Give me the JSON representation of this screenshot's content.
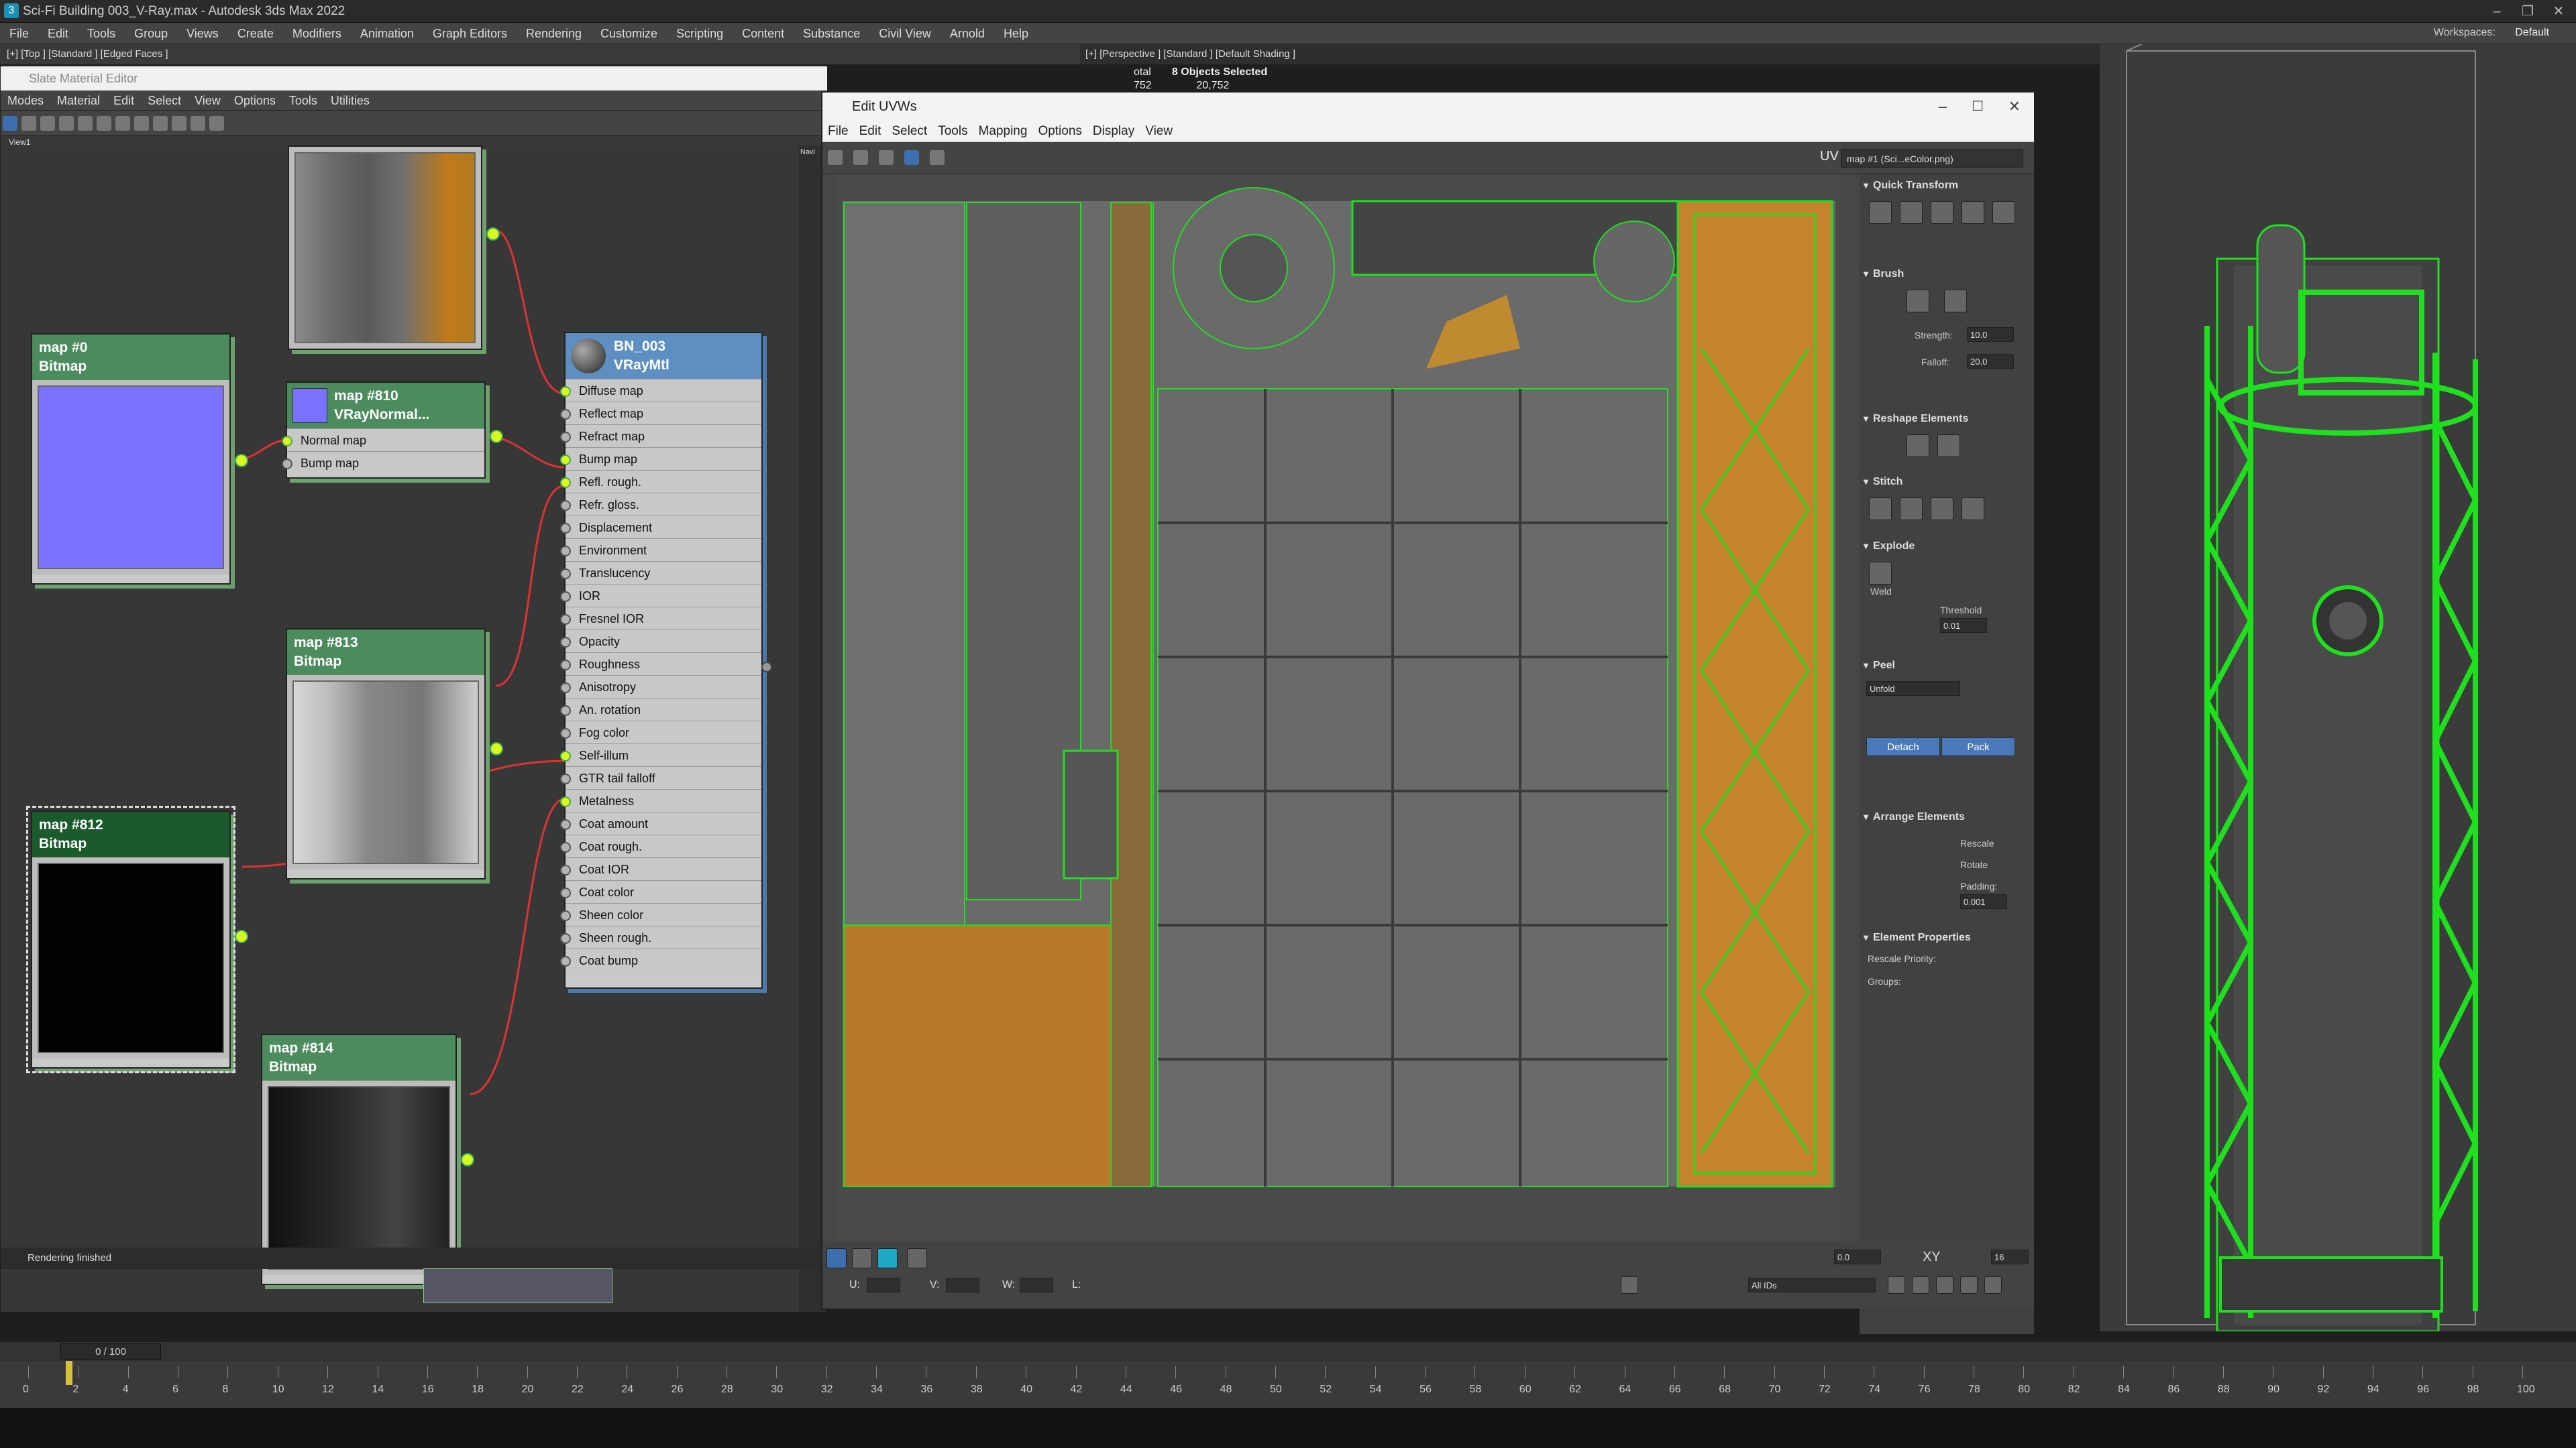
{
  "app": {
    "title": "Sci-Fi Building 003_V-Ray.max - Autodesk 3ds Max 2022",
    "menu": [
      "File",
      "Edit",
      "Tools",
      "Group",
      "Views",
      "Create",
      "Modifiers",
      "Animation",
      "Graph Editors",
      "Rendering",
      "Customize",
      "Scripting",
      "Content",
      "Substance",
      "Civil View",
      "Arnold",
      "Help"
    ],
    "workspaces_label": "Workspaces:",
    "workspaces_value": "Default"
  },
  "viewports": {
    "top_label": "[+] [Top ] [Standard ] [Edged Faces ]",
    "persp_label": "[+] [Perspective ] [Standard ] [Default Shading ]",
    "stats_total": "otal",
    "stats_selected": "8 Objects Selected",
    "stats_num1": "752",
    "stats_num2": "20,752"
  },
  "slate": {
    "title": "Slate Material Editor",
    "menu": [
      "Modes",
      "Material",
      "Edit",
      "Select",
      "View",
      "Options",
      "Tools",
      "Utilities"
    ],
    "view_tab": "View1",
    "status": "Rendering finished",
    "nav_label": "Navi",
    "nodes": {
      "map0": {
        "name": "map #0",
        "type": "Bitmap"
      },
      "map810": {
        "name": "map #810",
        "type": "VRayNormal...",
        "slots": [
          "Normal map",
          "Bump map"
        ]
      },
      "map813": {
        "name": "map #813",
        "type": "Bitmap"
      },
      "map812": {
        "name": "map #812",
        "type": "Bitmap"
      },
      "map814": {
        "name": "map #814",
        "type": "Bitmap"
      },
      "mtl": {
        "name": "BN_003",
        "type": "VRayMtl",
        "slots": [
          "Diffuse map",
          "Reflect map",
          "Refract map",
          "Bump map",
          "Refl. rough.",
          "Refr. gloss.",
          "Displacement",
          "Environment",
          "Translucency",
          "IOR",
          "Fresnel IOR",
          "Opacity",
          "Roughness",
          "Anisotropy",
          "An. rotation",
          "Fog color",
          "Self-illum",
          "GTR tail falloff",
          "Metalness",
          "Coat amount",
          "Coat rough.",
          "Coat IOR",
          "Coat color",
          "Sheen color",
          "Sheen rough.",
          "Coat bump"
        ],
        "connected": [
          0,
          3,
          4,
          16,
          18
        ]
      }
    }
  },
  "uvw": {
    "title": "Edit UVWs",
    "menu": [
      "File",
      "Edit",
      "Select",
      "Tools",
      "Mapping",
      "Options",
      "Display",
      "View"
    ],
    "uv_label": "UV",
    "map_select": "map #1 (Sci...eColor.png)",
    "panel": {
      "quick_transform": "Quick Transform",
      "brush": "Brush",
      "strength_label": "Strength:",
      "strength": "10.0",
      "falloff_label": "Falloff:",
      "falloff": "20.0",
      "reshape": "Reshape Elements",
      "stitch": "Stitch",
      "explode": "Explode",
      "weld": "Weld",
      "threshold_label": "Threshold",
      "threshold": "0.01",
      "peel": "Peel",
      "unfold": "Unfold",
      "detach": "Detach",
      "pack": "Pack",
      "arrange": "Arrange Elements",
      "rescale": "Rescale",
      "rotate": "Rotate",
      "padding_label": "Padding:",
      "padding": "0.001",
      "elem_props": "Element Properties",
      "rescale_priority": "Rescale Priority:",
      "groups": "Groups:"
    },
    "bottom": {
      "zoom": "0.0",
      "xy": "XY",
      "grid": "16",
      "u_label": "U:",
      "v_label": "V:",
      "w_label": "W:",
      "l_label": "L:",
      "ids": "All IDs"
    }
  },
  "timeline": {
    "slider": "0 / 100",
    "ticks": [
      "0",
      "2",
      "4",
      "6",
      "8",
      "10",
      "12",
      "14",
      "16",
      "18",
      "20",
      "22",
      "24",
      "26",
      "28",
      "30",
      "32",
      "34",
      "36",
      "38",
      "40",
      "42",
      "44",
      "46",
      "48",
      "50",
      "52",
      "54",
      "56",
      "58",
      "60",
      "62",
      "64",
      "66",
      "68",
      "70",
      "72",
      "74",
      "76",
      "78",
      "80",
      "82",
      "84",
      "86",
      "88",
      "90",
      "92",
      "94",
      "96",
      "98",
      "100"
    ]
  }
}
